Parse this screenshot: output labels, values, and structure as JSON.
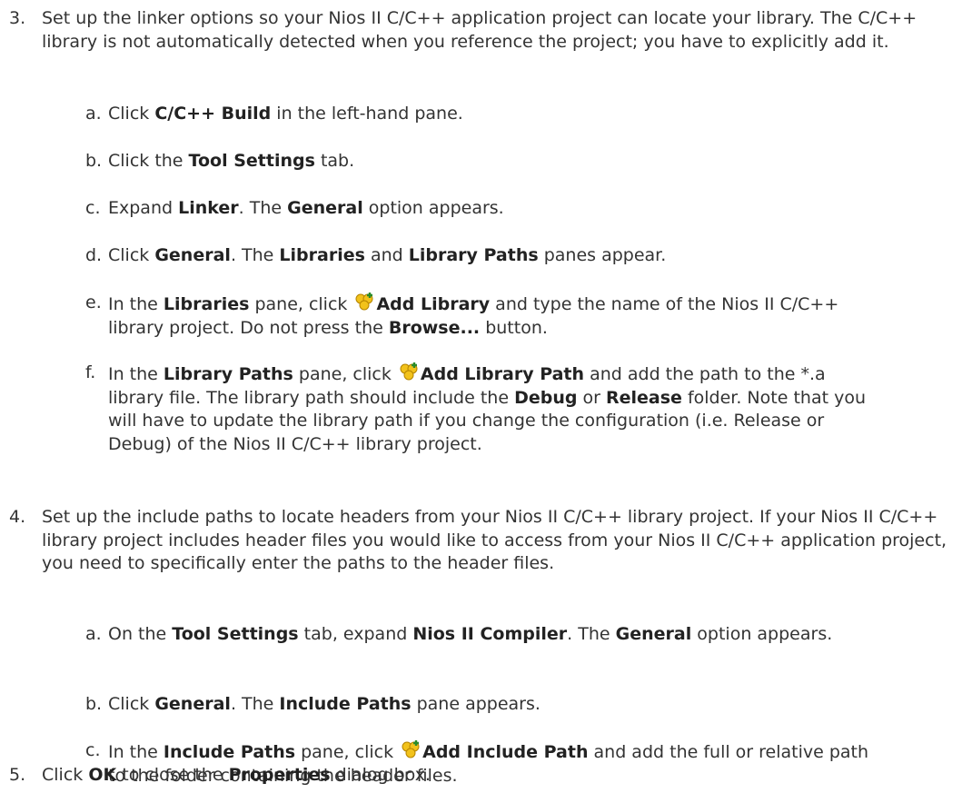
{
  "steps": [
    {
      "num": "3.",
      "parts": [
        "Set up the linker options so your Nios II C/C++ application project can locate your library. The C/C++ library is not automatically detected when you reference the project; you have to explicitly add it."
      ],
      "subs": [
        {
          "letter": "a.",
          "t": [
            "Click ",
            "C/C++ Build",
            " in the left-hand pane."
          ]
        },
        {
          "letter": "b.",
          "t": [
            "Click the ",
            "Tool Settings",
            " tab."
          ]
        },
        {
          "letter": "c.",
          "t": [
            "Expand ",
            "Linker",
            ". The ",
            "General",
            " option appears."
          ]
        },
        {
          "letter": "d.",
          "t": [
            "Click ",
            "General",
            ". The ",
            "Libraries",
            " and ",
            "Library Paths",
            " panes appear."
          ]
        },
        {
          "letter": "e.",
          "t": [
            "In the ",
            "Libraries",
            " pane, click ",
            "Add Library",
            " and type the name of the Nios II C/C++ library project. Do not press the ",
            "Browse...",
            " button."
          ]
        },
        {
          "letter": "f.",
          "t": [
            "In the ",
            "Library Paths",
            " pane, click ",
            "Add Library Path",
            " and add the path to the *.a library file. The library path should include the ",
            "Debug",
            " or ",
            "Release",
            " folder. Note that you will have to update the library path if you change the configuration (i.e. Release or Debug) of the Nios II C/C++ library project."
          ]
        }
      ]
    },
    {
      "num": "4.",
      "parts": [
        "Set up the include paths to locate headers from your Nios II C/C++ library project. If your Nios II C/C++ library project includes header files you would like to access from your Nios II C/C++ application project, you need to specifically enter the paths to the header files."
      ],
      "subs": [
        {
          "letter": "a.",
          "t": [
            "On the ",
            "Tool Settings",
            " tab, expand ",
            "Nios II Compiler",
            ". The ",
            "General",
            " option appears."
          ]
        },
        {
          "letter": "b.",
          "t": [
            "Click ",
            "General",
            ". The ",
            "Include Paths",
            " pane appears."
          ]
        },
        {
          "letter": "c.",
          "t": [
            "In the ",
            "Include Paths",
            " pane, click ",
            "Add Include Path",
            " and add the full or relative path to the folder containing the header files."
          ]
        }
      ]
    },
    {
      "num": "5.",
      "t": [
        "Click ",
        "OK",
        " to close the ",
        "Properties",
        " dialog box."
      ]
    }
  ],
  "icons": {
    "add": "add-icon"
  }
}
